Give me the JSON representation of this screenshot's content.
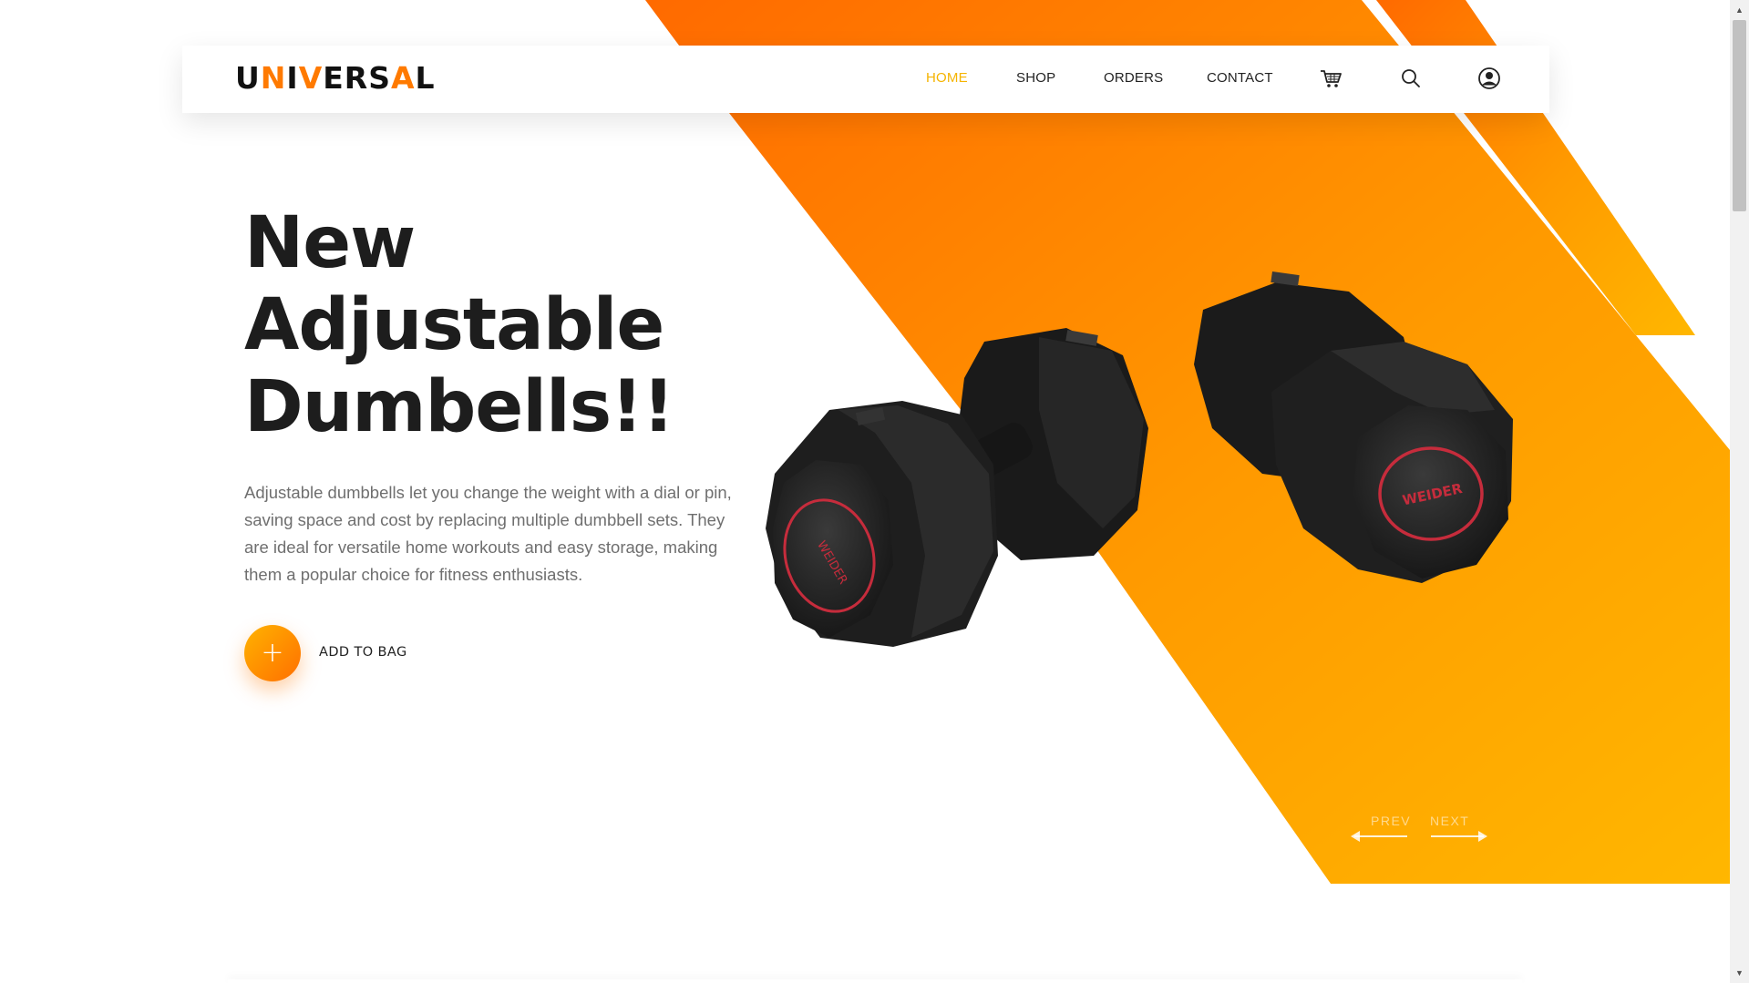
{
  "brand": {
    "logo_pre": "U",
    "logo_accent_1": "N",
    "logo_mid": "I",
    "logo_accent_2": "V",
    "logo_post": "ERS",
    "logo_accent_3": "A",
    "logo_end": "L"
  },
  "nav": {
    "items": [
      {
        "label": "HOME",
        "active": true
      },
      {
        "label": "SHOP",
        "active": false
      },
      {
        "label": "ORDERS",
        "active": false
      },
      {
        "label": "CONTACT",
        "active": false
      }
    ],
    "icons": [
      "cart-icon",
      "search-icon",
      "user-icon"
    ]
  },
  "hero": {
    "title_lines": [
      "New",
      "Adjustable",
      "Dumbells!!"
    ],
    "description": "Adjustable dumbbells let you change the weight with a dial or pin, saving space and cost by replacing multiple dumbbell sets. They are ideal for versatile home workouts and easy storage, making them a popular choice for fitness enthusiasts.",
    "add_button_symbol": "+",
    "add_label": "ADD TO BAG",
    "product_brand": "WEIDER"
  },
  "pager": {
    "prev": "PREV",
    "next": "NEXT"
  },
  "colors": {
    "accent": "#ff7a00",
    "accent_light": "#ffb300",
    "active_nav": "#f5b400",
    "text_dark": "#1d1d1d",
    "text_muted": "#6f6f6f"
  }
}
